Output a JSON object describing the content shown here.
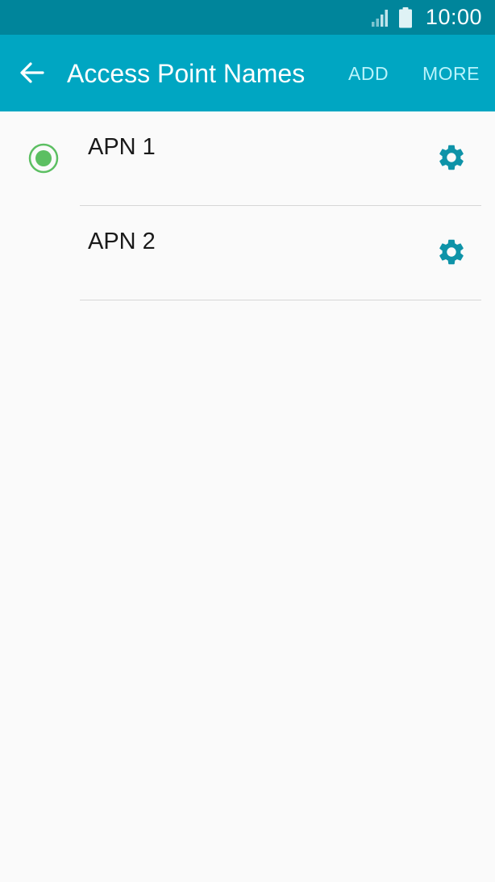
{
  "status_bar": {
    "time": "10:00",
    "icons": [
      "signal-icon",
      "battery-icon"
    ]
  },
  "app_bar": {
    "back_icon": "arrow-left-icon",
    "title": "Access Point Names",
    "actions": {
      "add_label": "ADD",
      "more_label": "MORE"
    }
  },
  "apn_list": [
    {
      "name": "APN 1",
      "selected": true,
      "settings_icon": "gear-icon"
    },
    {
      "name": "APN 2",
      "selected": false,
      "settings_icon": "gear-icon"
    }
  ],
  "colors": {
    "status_bar": "#00859b",
    "app_bar": "#00a6c2",
    "action_text": "#b9f3fb",
    "radio_selected": "#5cbf62",
    "gear": "#0e93a8",
    "background": "#fafafa",
    "divider": "#d6d6d6"
  }
}
